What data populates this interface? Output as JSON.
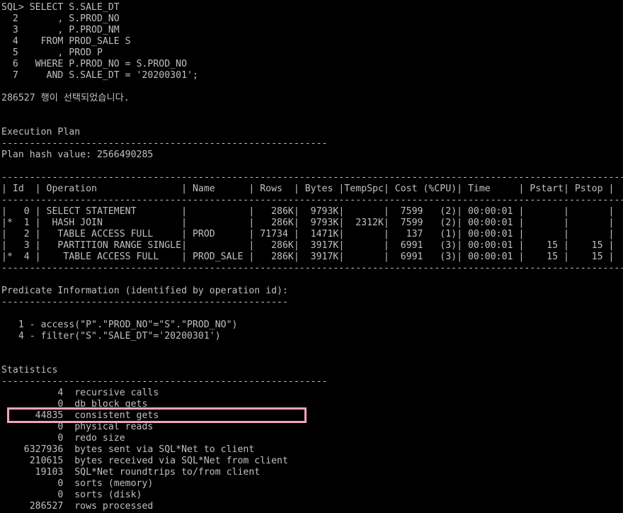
{
  "console": {
    "lines": [
      "SQL> SELECT S.SALE_DT",
      "  2       , S.PROD_NO",
      "  3       , P.PROD_NM",
      "  4    FROM PROD_SALE S",
      "  5       , PROD P",
      "  6   WHERE P.PROD_NO = S.PROD_NO",
      "  7     AND S.SALE_DT = '20200301';",
      "",
      "286527 행이 선택되었습니다.",
      "",
      "",
      "Execution Plan",
      "----------------------------------------------------------",
      "Plan hash value: 2566490285",
      "",
      "---------------------------------------------------------------------------------------------------------------",
      "| Id  | Operation               | Name      | Rows  | Bytes |TempSpc| Cost (%CPU)| Time     | Pstart| Pstop |",
      "---------------------------------------------------------------------------------------------------------------",
      "|   0 | SELECT STATEMENT        |           |   286K|  9793K|       |  7599   (2)| 00:00:01 |       |       |",
      "|*  1 |  HASH JOIN              |           |   286K|  9793K|  2312K|  7599   (2)| 00:00:01 |       |       |",
      "|   2 |   TABLE ACCESS FULL     | PROD      | 71734 |  1471K|       |   137   (1)| 00:00:01 |       |       |",
      "|   3 |   PARTITION RANGE SINGLE|           |   286K|  3917K|       |  6991   (3)| 00:00:01 |    15 |    15 |",
      "|*  4 |    TABLE ACCESS FULL    | PROD_SALE |   286K|  3917K|       |  6991   (3)| 00:00:01 |    15 |    15 |",
      "---------------------------------------------------------------------------------------------------------------",
      "",
      "Predicate Information (identified by operation id):",
      "---------------------------------------------------",
      "",
      "   1 - access(\"P\".\"PROD_NO\"=\"S\".\"PROD_NO\")",
      "   4 - filter(\"S\".\"SALE_DT\"='20200301')",
      "",
      "",
      "Statistics",
      "----------------------------------------------------------",
      "          4  recursive calls",
      "          0  db block gets",
      "      44835  consistent gets",
      "          0  physical reads",
      "          0  redo size",
      "    6327936  bytes sent via SQL*Net to client",
      "     210615  bytes received via SQL*Net from client",
      "      19103  SQL*Net roundtrips to/from client",
      "          0  sorts (memory)",
      "          0  sorts (disk)",
      "     286527  rows processed"
    ]
  },
  "colors": {
    "background": "#000000",
    "text": "#c0c0c0",
    "highlight": "#f2a3c0"
  }
}
